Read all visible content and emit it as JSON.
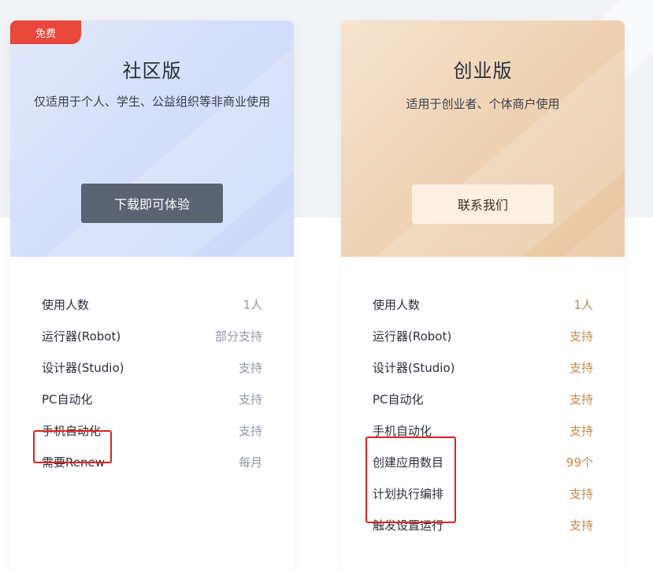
{
  "plans": {
    "community": {
      "badge": "免费",
      "title": "社区版",
      "description": "仅适用于个人、学生、公益组织等非商业使用",
      "cta_label": "下载即可体验",
      "features": [
        {
          "label": "使用人数",
          "value": "1人"
        },
        {
          "label": "运行器(Robot)",
          "value": "部分支持"
        },
        {
          "label": "设计器(Studio)",
          "value": "支持"
        },
        {
          "label": "PC自动化",
          "value": "支持"
        },
        {
          "label": "手机自动化",
          "value": "支持"
        },
        {
          "label": "需要Renew",
          "value": "每月"
        }
      ]
    },
    "startup": {
      "title": "创业版",
      "description": "适用于创业者、个体商户使用",
      "cta_label": "联系我们",
      "features": [
        {
          "label": "使用人数",
          "value": "1人"
        },
        {
          "label": "运行器(Robot)",
          "value": "支持"
        },
        {
          "label": "设计器(Studio)",
          "value": "支持"
        },
        {
          "label": "PC自动化",
          "value": "支持"
        },
        {
          "label": "手机自动化",
          "value": "支持"
        },
        {
          "label": "创建应用数目",
          "value": "99个"
        },
        {
          "label": "计划执行编排",
          "value": "支持"
        },
        {
          "label": "触发设置运行",
          "value": "支持"
        }
      ]
    }
  },
  "colors": {
    "badge": "#e8473a",
    "highlight_box": "#e02020",
    "community_value": "#9097a3",
    "startup_value": "#bf8a4f",
    "dark_button": "#5b6270",
    "light_button": "#fdf0e0"
  }
}
